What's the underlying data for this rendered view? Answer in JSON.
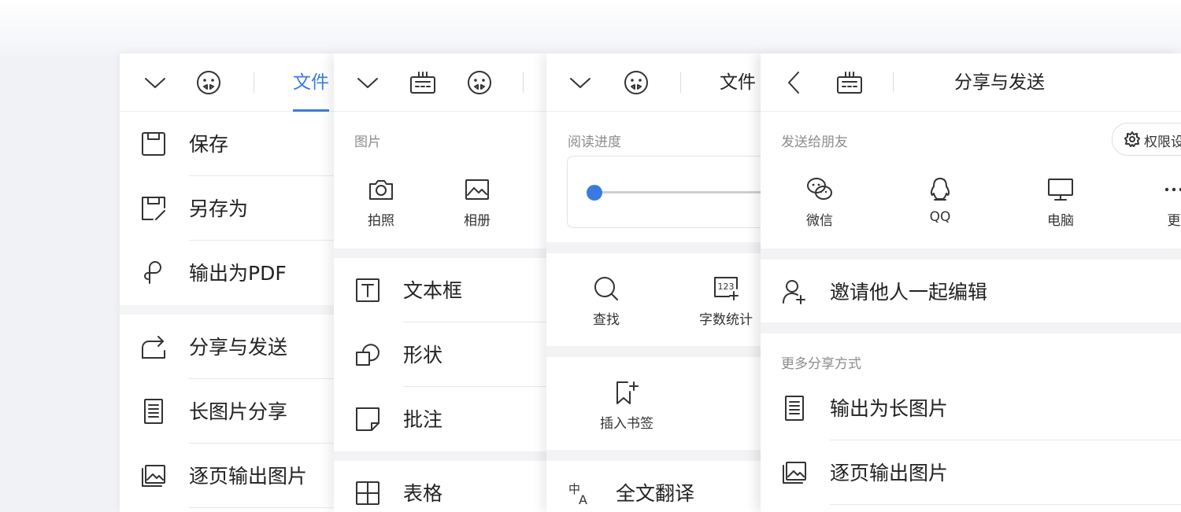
{
  "panel1": {
    "tab_label": "文件",
    "items": [
      {
        "label": "保存",
        "icon": "save-icon"
      },
      {
        "label": "另存为",
        "icon": "save-as-icon"
      },
      {
        "label": "输出为PDF",
        "icon": "pdf-icon"
      },
      {
        "label": "分享与发送",
        "icon": "share-icon"
      },
      {
        "label": "长图片分享",
        "icon": "long-image-icon"
      },
      {
        "label": "逐页输出图片",
        "icon": "image-pages-icon"
      }
    ]
  },
  "panel2": {
    "picture_section_title": "图片",
    "picture_items": [
      {
        "label": "拍照",
        "icon": "camera-icon"
      },
      {
        "label": "相册",
        "icon": "album-icon"
      }
    ],
    "items": [
      {
        "label": "文本框",
        "icon": "textbox-icon"
      },
      {
        "label": "形状",
        "icon": "shape-icon"
      },
      {
        "label": "批注",
        "icon": "comment-icon"
      },
      {
        "label": "表格",
        "icon": "table-icon"
      }
    ]
  },
  "panel3": {
    "tab_label": "文件",
    "progress_title": "阅读进度",
    "progress_value": 0,
    "tools": [
      {
        "label": "查找",
        "icon": "search-icon"
      },
      {
        "label": "字数统计",
        "icon": "word-count-icon"
      }
    ],
    "bookmark_label": "插入书签",
    "translate_label": "全文翻译"
  },
  "panel4": {
    "title": "分享与发送",
    "send_section_title": "发送给朋友",
    "permission_label": "权限设",
    "send_targets": [
      {
        "label": "微信",
        "icon": "wechat-icon"
      },
      {
        "label": "QQ",
        "icon": "qq-icon"
      },
      {
        "label": "电脑",
        "icon": "computer-icon"
      },
      {
        "label": "更",
        "icon": "more-icon"
      }
    ],
    "invite_label": "邀请他人一起编辑",
    "more_section_title": "更多分享方式",
    "more_items": [
      {
        "label": "输出为长图片",
        "icon": "long-image-icon"
      },
      {
        "label": "逐页输出图片",
        "icon": "image-pages-icon"
      }
    ]
  },
  "colors": {
    "accent": "#3b7be0",
    "background": "#f1f2f6"
  }
}
